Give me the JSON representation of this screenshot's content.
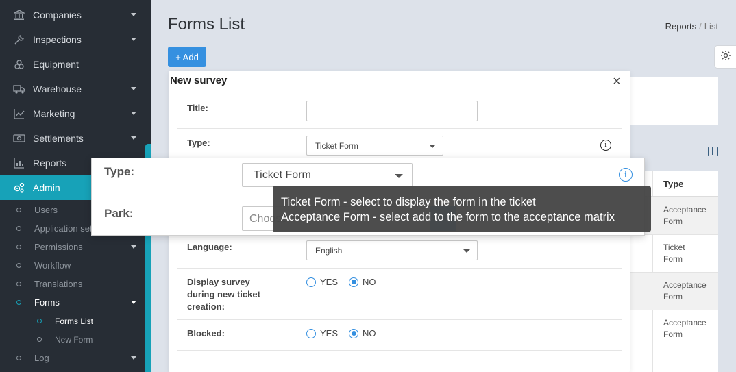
{
  "sidebar": {
    "items": [
      {
        "label": "Companies",
        "icon": "bank-icon",
        "has_caret": true
      },
      {
        "label": "Inspections",
        "icon": "wrench-icon",
        "has_caret": true
      },
      {
        "label": "Equipment",
        "icon": "equipment-icon",
        "has_caret": false
      },
      {
        "label": "Warehouse",
        "icon": "truck-icon",
        "has_caret": true
      },
      {
        "label": "Marketing",
        "icon": "chart-line-icon",
        "has_caret": true
      },
      {
        "label": "Settlements",
        "icon": "money-icon",
        "has_caret": true
      },
      {
        "label": "Reports",
        "icon": "bar-chart-icon",
        "has_caret": false
      },
      {
        "label": "Admin",
        "icon": "cogs-icon",
        "has_caret": false,
        "active": true
      }
    ],
    "admin_sub": [
      {
        "label": "Users"
      },
      {
        "label": "Application sett"
      },
      {
        "label": "Permissions"
      },
      {
        "label": "Workflow"
      },
      {
        "label": "Translations"
      },
      {
        "label": "Forms"
      },
      {
        "label": "Log"
      }
    ],
    "forms_sub": [
      {
        "label": "Forms List"
      },
      {
        "label": "New Form"
      }
    ],
    "accent_color": "#17a2b8"
  },
  "header": {
    "page_title": "Forms List",
    "breadcrumb": [
      "Reports",
      "/",
      "List"
    ],
    "add_button": "+ Add"
  },
  "table": {
    "type_header": "Type",
    "rows": [
      {
        "type_line1": "Acceptance",
        "type_line2": "Form"
      },
      {
        "type_line1": "Ticket",
        "type_line2": "Form"
      },
      {
        "type_line1": "Acceptance",
        "type_line2": "Form"
      },
      {
        "type_line1": "Acceptance",
        "type_line2": "Form"
      }
    ]
  },
  "modal": {
    "title": "New survey",
    "close_icon": "×",
    "fields": {
      "title_label": "Title:",
      "title_value": "",
      "type_label": "Type:",
      "type_value": "Ticket Form",
      "language_label": "Language:",
      "language_value": "English",
      "display_label_1": "Display survey",
      "display_label_2": "during new ticket",
      "display_label_3": "creation:",
      "blocked_label": "Blocked:",
      "yes": "YES",
      "no": "NO"
    }
  },
  "zoom": {
    "type_label": "Type:",
    "type_value": "Ticket Form",
    "park_label": "Park:",
    "park_placeholder": "Choose",
    "info_glyph": "i"
  },
  "tooltip": {
    "line1": "Ticket Form - select to display the form in the ticket",
    "line2": "Acceptance Form - select add to the form to the acceptance matrix"
  },
  "colors": {
    "primary": "#3590e0",
    "sidebar_bg": "#272d35",
    "page_bg": "#dde2ea"
  }
}
